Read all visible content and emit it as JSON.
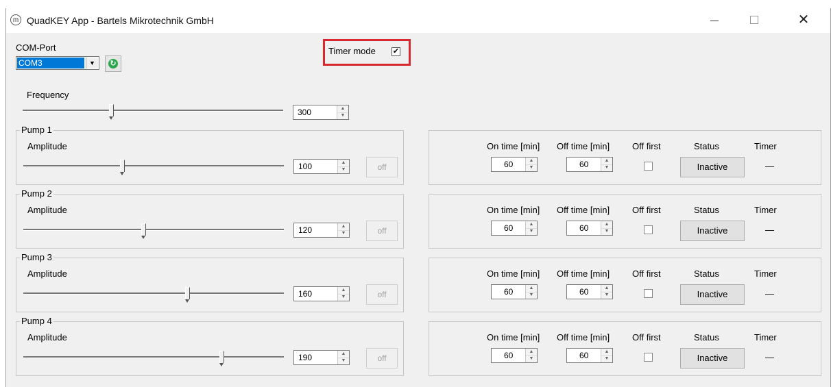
{
  "window": {
    "title": "QuadKEY App - Bartels Mikrotechnik GmbH",
    "app_icon": "m-logo-icon"
  },
  "com": {
    "label": "COM-Port",
    "selected": "COM3",
    "refresh_icon": "refresh-icon"
  },
  "timer_mode": {
    "label": "Timer mode",
    "checked": true
  },
  "frequency": {
    "label": "Frequency",
    "value": "300",
    "slider_fraction": 0.34
  },
  "timer_headers": {
    "on_time": "On time [min]",
    "off_time": "Off time [min]",
    "off_first": "Off first",
    "status": "Status",
    "timer": "Timer"
  },
  "pumps": [
    {
      "name": "Pump 1",
      "amplitude_label": "Amplitude",
      "amplitude": "100",
      "slider_fraction": 0.38,
      "button": "off",
      "on_time": "60",
      "off_time": "60",
      "off_first": false,
      "status": "Inactive",
      "timer": "—"
    },
    {
      "name": "Pump 2",
      "amplitude_label": "Amplitude",
      "amplitude": "120",
      "slider_fraction": 0.46,
      "button": "off",
      "on_time": "60",
      "off_time": "60",
      "off_first": false,
      "status": "Inactive",
      "timer": "—"
    },
    {
      "name": "Pump 3",
      "amplitude_label": "Amplitude",
      "amplitude": "160",
      "slider_fraction": 0.63,
      "button": "off",
      "on_time": "60",
      "off_time": "60",
      "off_first": false,
      "status": "Inactive",
      "timer": "—"
    },
    {
      "name": "Pump 4",
      "amplitude_label": "Amplitude",
      "amplitude": "190",
      "slider_fraction": 0.76,
      "button": "off",
      "on_time": "60",
      "off_time": "60",
      "off_first": false,
      "status": "Inactive",
      "timer": "—"
    }
  ],
  "colors": {
    "highlight": "#d7282f",
    "selection": "#0078d7",
    "refresh": "#2aa84a"
  }
}
